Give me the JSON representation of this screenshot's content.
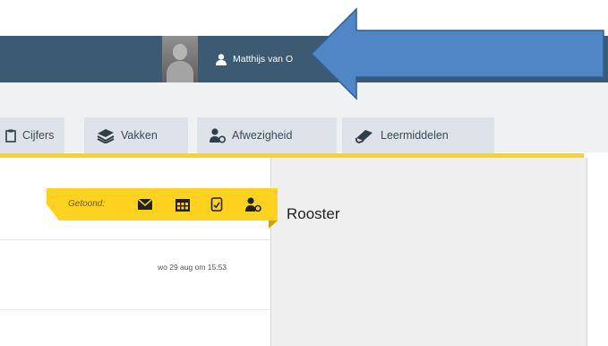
{
  "header": {
    "user_name": "Matthijs van O"
  },
  "tabs": [
    {
      "label": "Cijfers",
      "icon": "clipboard-icon"
    },
    {
      "label": "Vakken",
      "icon": "books-icon"
    },
    {
      "label": "Afwezigheid",
      "icon": "user-absence-icon"
    },
    {
      "label": "Leermiddelen",
      "icon": "book-icon"
    }
  ],
  "filter": {
    "label": "Getoond:",
    "icons": [
      "mail-icon",
      "calendar-icon",
      "document-check-icon",
      "user-absence-icon"
    ]
  },
  "message": {
    "date": "wo 29 aug om 15:53"
  },
  "panel": {
    "title": "Rooster"
  },
  "colors": {
    "topbar": "#3c5a72",
    "accent_yellow": "#ffd21f",
    "tab_bg": "#dde3e9",
    "arrow": "#4f86c6"
  }
}
